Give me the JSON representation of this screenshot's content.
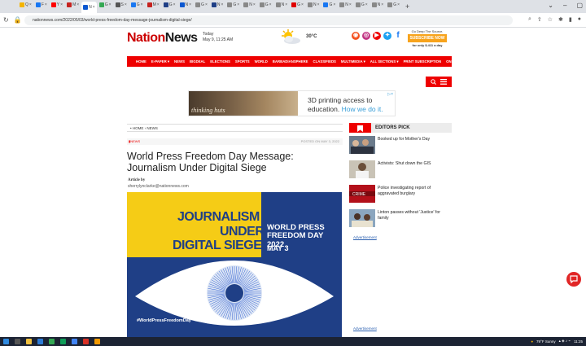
{
  "browser": {
    "tabs": [
      {
        "label": "Q",
        "color": "#f4b400"
      },
      {
        "label": "F",
        "color": "#1877f2"
      },
      {
        "label": "Y",
        "color": "#ff0000"
      },
      {
        "label": "M",
        "color": "#c5221f"
      },
      {
        "label": "N",
        "color": "#0b57d0"
      },
      {
        "label": "G",
        "color": "#34a853"
      },
      {
        "label": "S",
        "color": "#555555"
      },
      {
        "label": "G",
        "color": "#1877f2"
      },
      {
        "label": "M",
        "color": "#c5221f"
      },
      {
        "label": "G",
        "color": "#1f3f86"
      },
      {
        "label": "N",
        "color": "#0b57d0"
      },
      {
        "label": "G",
        "color": "#888888"
      },
      {
        "label": "N",
        "color": "#1f3f86"
      },
      {
        "label": "G",
        "color": "#888888"
      },
      {
        "label": "N",
        "color": "#888888"
      },
      {
        "label": "G",
        "color": "#888888"
      },
      {
        "label": "N",
        "color": "#888888"
      },
      {
        "label": "G",
        "color": "#e00000"
      },
      {
        "label": "N",
        "color": "#888888"
      },
      {
        "label": "G",
        "color": "#1877f2"
      },
      {
        "label": "N",
        "color": "#888888"
      },
      {
        "label": "G",
        "color": "#888888"
      },
      {
        "label": "N",
        "color": "#888888"
      },
      {
        "label": "G",
        "color": "#888888"
      }
    ],
    "url": "nationnews.com/2022/05/03/world-press-freedom-day-message-journalism-digital-siege/"
  },
  "site": {
    "logo_a": "Nation",
    "logo_b": "News",
    "date_day": "Today",
    "date_full": "May 9, 11:25 AM",
    "temperature": "30°C",
    "subscribe_tag": "Go Deep The Source.",
    "subscribe_btn": "SUBSCRIBE NOW",
    "subscribe_price": "for only $.411 a day",
    "nav": [
      "HOME",
      "E-PAPER ▾",
      "NEWS",
      "BIGDEAL",
      "ELECTIONS",
      "SPORTS",
      "WORLD",
      "BARBADIANSPHERE",
      "CLASSIFIEDS",
      "MULTIMEDIA ▾",
      "ALL SECTIONS ▾",
      "PRINT SUBSCRIPTION",
      "ON POINT"
    ],
    "colors": {
      "brand": "#e00000",
      "accent": "#f7a31c",
      "navy": "#1f3f86",
      "yellow": "#f5cc16"
    }
  },
  "ad": {
    "brand": "thinking huts",
    "line1": "3D printing access to",
    "line2a": "education.",
    "line2b": "How we do it.",
    "corner": "▷×"
  },
  "article": {
    "breadcrumb": "• HOME › NEWS",
    "category": "NEWS",
    "posted": "POSTED ON MAY 3, 2022",
    "headline": "World Press Freedom Day Message: Journalism Under Digital Siege",
    "byline_label": "Article by",
    "byline_email": "sherrylynclarke@nationnews.com",
    "hero": {
      "j1": "JOURNALISM",
      "j2": "UNDER",
      "j3": "DIGITAL SIEGE",
      "w1": "WORLD PRESS",
      "w2": "FREEDOM DAY 2022",
      "may": "MAY 3",
      "hashtag": "#WorldPressFreedomDay"
    }
  },
  "sidebar": {
    "title": "EDITORS PICK",
    "items": [
      {
        "title": "Booked up for Mother's Day"
      },
      {
        "title": "Activists: Shut down the GIS"
      },
      {
        "title": "Police investigating report of aggravated burglary"
      },
      {
        "title": "Linton passes without 'Justice' for family"
      }
    ],
    "ad_link": "Advertisement"
  },
  "taskbar": {
    "weather": "79°F Sunny",
    "time": "11:25"
  }
}
